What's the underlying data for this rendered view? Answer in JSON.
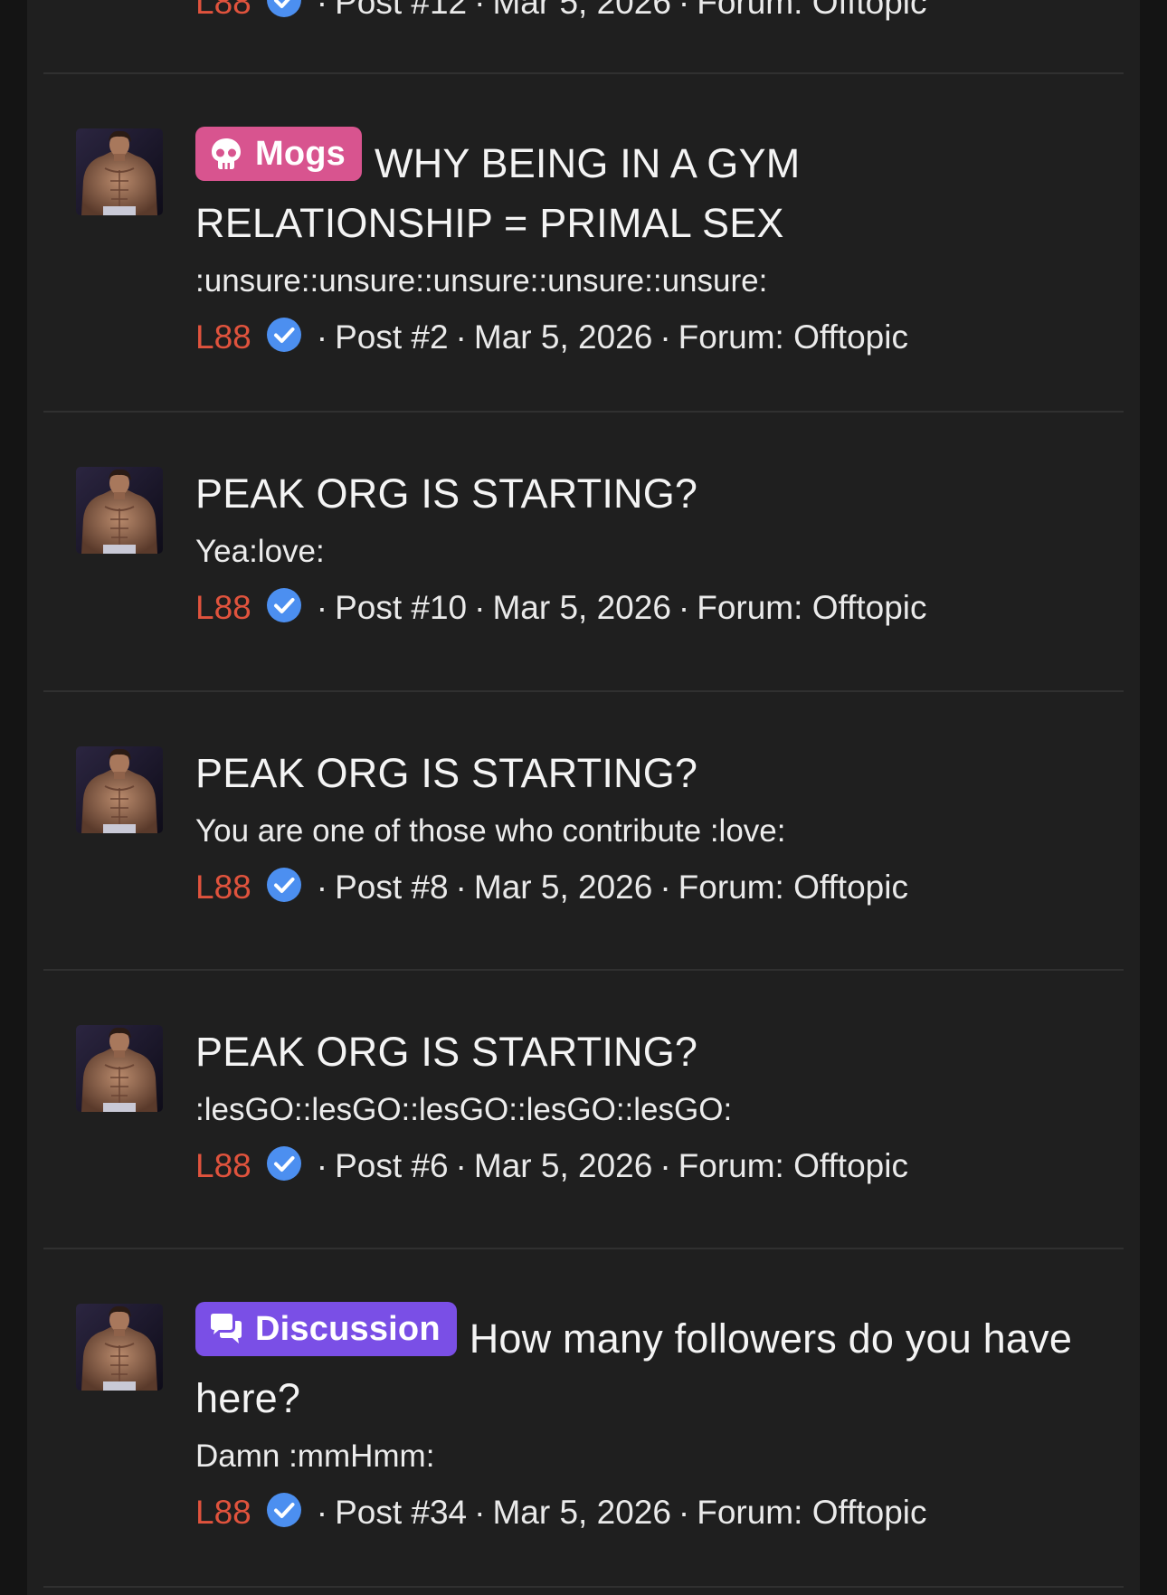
{
  "colors": {
    "page_bg": "#141414",
    "panel_bg": "#1f1f1f",
    "divider": "#303030",
    "username": "#e0533d",
    "verified": "#4c8ff0",
    "prefix_mogs": "#d8548f",
    "prefix_discussion": "#7a4fe6"
  },
  "icons": {
    "verified": "verified-check-icon",
    "mogs_prefix": "skull-icon",
    "discussion_prefix": "chat-bubbles-icon"
  },
  "meta_separator": "·",
  "results": [
    {
      "prefix": "",
      "title": "",
      "snippet": "",
      "user": "L88",
      "post": "Post #12",
      "date": "Mar 5, 2026",
      "forum": "Forum: Offtopic"
    },
    {
      "prefix": "Mogs",
      "title": "WHY BEING IN A GYM RELATIONSHIP = PRIMAL SEX",
      "snippet": ":unsure::unsure::unsure::unsure::unsure:",
      "user": "L88",
      "post": "Post #2",
      "date": "Mar 5, 2026",
      "forum": "Forum: Offtopic"
    },
    {
      "prefix": "",
      "title": "PEAK ORG IS STARTING?",
      "snippet": "Yea:love:",
      "user": "L88",
      "post": "Post #10",
      "date": "Mar 5, 2026",
      "forum": "Forum: Offtopic"
    },
    {
      "prefix": "",
      "title": "PEAK ORG IS STARTING?",
      "snippet": "You are one of those who contribute :love:",
      "user": "L88",
      "post": "Post #8",
      "date": "Mar 5, 2026",
      "forum": "Forum: Offtopic"
    },
    {
      "prefix": "",
      "title": "PEAK ORG IS STARTING?",
      "snippet": ":lesGO::lesGO::lesGO::lesGO::lesGO:",
      "user": "L88",
      "post": "Post #6",
      "date": "Mar 5, 2026",
      "forum": "Forum: Offtopic"
    },
    {
      "prefix": "Discussion",
      "title": "How many followers do you have here?",
      "snippet": "Damn :mmHmm:",
      "user": "L88",
      "post": "Post #34",
      "date": "Mar 5, 2026",
      "forum": "Forum: Offtopic"
    }
  ]
}
